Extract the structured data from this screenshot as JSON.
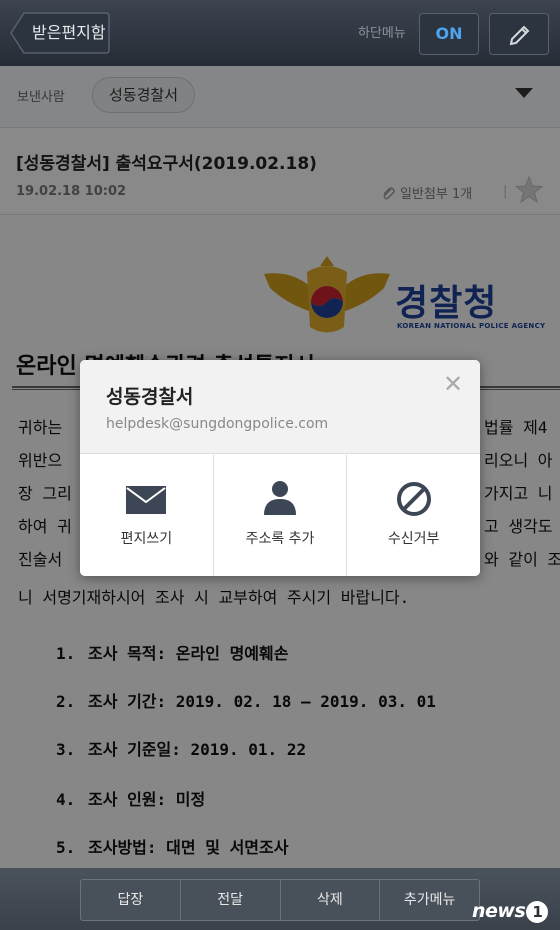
{
  "topbar": {
    "back_label": "받은편지함",
    "bottom_menu_label": "하단메뉴",
    "bottom_menu_toggle": "ON"
  },
  "sender": {
    "label": "보낸사람",
    "name": "성동경찰서"
  },
  "mail": {
    "subject": "[성동경찰서] 출석요구서(2019.02.18)",
    "date": "19.02.18 10:02",
    "attachment": "일반첨부 1개"
  },
  "document": {
    "logo_text": "경찰청",
    "logo_subtitle": "KOREAN NATIONAL POLICE AGENCY",
    "heading": "온라인 명예훼손관련 출석통지서",
    "paragraph": [
      "귀하는",
      "위반으",
      "장 그리",
      "하여 귀",
      "진술서",
      "니 서명기재하시어 조사 시 교부하여 주시기 바랍니다."
    ],
    "paragraph_right": [
      "법률 제4",
      "리오니 아",
      "가지고 니",
      "고 생각도",
      "와 같이 조"
    ],
    "items": [
      {
        "num": "1.",
        "text": "조사 목적: 온라인 명예훼손"
      },
      {
        "num": "2.",
        "text": "조사 기간: 2019. 02. 18 – 2019. 03. 01"
      },
      {
        "num": "3.",
        "text": "조사 기준일: 2019. 01. 22"
      },
      {
        "num": "4.",
        "text": "조사 인원: 미정"
      },
      {
        "num": "5.",
        "text": "조사방법: 대면 및 서면조사"
      }
    ]
  },
  "popup": {
    "name": "성동경찰서",
    "email": "helpdesk@sungdongpolice.com",
    "close": "✕",
    "actions": [
      {
        "label": "편지쓰기",
        "icon": "envelope-icon"
      },
      {
        "label": "주소록 추가",
        "icon": "person-icon"
      },
      {
        "label": "수신거부",
        "icon": "block-icon"
      }
    ]
  },
  "toolbar": {
    "buttons": [
      "답장",
      "전달",
      "삭제",
      "추가메뉴"
    ]
  },
  "watermark": {
    "text": "news",
    "badge": "1"
  },
  "colors": {
    "topbar": "#2f3640",
    "accent_blue": "#4ea4ef",
    "police_blue": "#1d3f95",
    "emblem_gold": "#c99a1e"
  }
}
